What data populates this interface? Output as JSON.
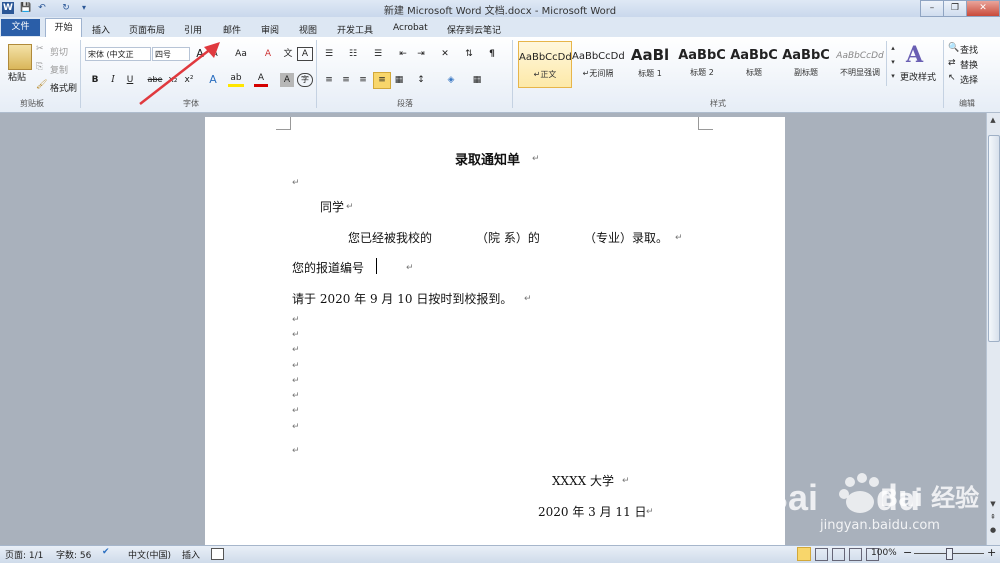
{
  "window": {
    "title": "新建 Microsoft Word 文档.docx - Microsoft Word",
    "controls": {
      "minimize": "–",
      "restore": "❐",
      "close": "✕"
    }
  },
  "quick_access": {
    "word_logo": "W",
    "save": "💾",
    "undo": "↶",
    "redo": "↻"
  },
  "tabs": {
    "file": "文件",
    "items": [
      "开始",
      "插入",
      "页面布局",
      "引用",
      "邮件",
      "审阅",
      "视图",
      "开发工具",
      "Acrobat",
      "保存到云笔记"
    ]
  },
  "ribbon": {
    "clipboard": {
      "paste": "粘贴",
      "cut": "剪切",
      "copy": "复制",
      "format_painter": "格式刷",
      "label": "剪贴板"
    },
    "font": {
      "font_name": "宋体 (中文正",
      "font_size": "四号",
      "grow": "A",
      "shrink": "A",
      "case": "Aa",
      "clear": "A",
      "pinyin": "文",
      "border": "A",
      "bold": "B",
      "italic": "I",
      "underline": "U",
      "strike": "abe",
      "subscript": "x₂",
      "superscript": "x²",
      "effects": "A",
      "highlight": "ab",
      "color": "A",
      "shade": "A",
      "enclose": "字",
      "label": "字体"
    },
    "paragraph": {
      "label": "段落"
    },
    "styles": {
      "items": [
        {
          "sample": "AaBbCcDd",
          "name": "↵正文"
        },
        {
          "sample": "AaBbCcDd",
          "name": "↵无间隔"
        },
        {
          "sample": "AaBl",
          "name": "标题 1"
        },
        {
          "sample": "AaBbC",
          "name": "标题 2"
        },
        {
          "sample": "AaBbC",
          "name": "标题"
        },
        {
          "sample": "AaBbC",
          "name": "副标题"
        },
        {
          "sample": "AaBbCcDd",
          "name": "不明显强调"
        }
      ],
      "change": "更改样式",
      "label": "样式"
    },
    "editing": {
      "find": "查找",
      "replace": "替换",
      "select": "选择",
      "label": "编辑"
    }
  },
  "document": {
    "title": "录取通知单",
    "line_student": "同学",
    "line_admitted_1": "您已经被我校的",
    "line_admitted_2": "（院 系）的",
    "line_admitted_3": "（专业）录取。",
    "line_number": "您的报道编号",
    "line_report": "请于 2020 年 9 月 10 日按时到校报到。",
    "university": "XXXX 大学",
    "date": "2020 年 3 月 11 日",
    "para_mark": "↵"
  },
  "statusbar": {
    "page": "页面: 1/1",
    "words": "字数: 56",
    "language": "中文(中国)",
    "insert": "插入",
    "zoom": "100%",
    "zoom_minus": "−",
    "zoom_plus": "+"
  },
  "watermark": {
    "text": "Bai 经验",
    "url": "jingyan.baidu.com"
  },
  "colors": {
    "file_tab": "#2a5ea8",
    "arrow": "#e0393e",
    "page": "#ffffff"
  }
}
